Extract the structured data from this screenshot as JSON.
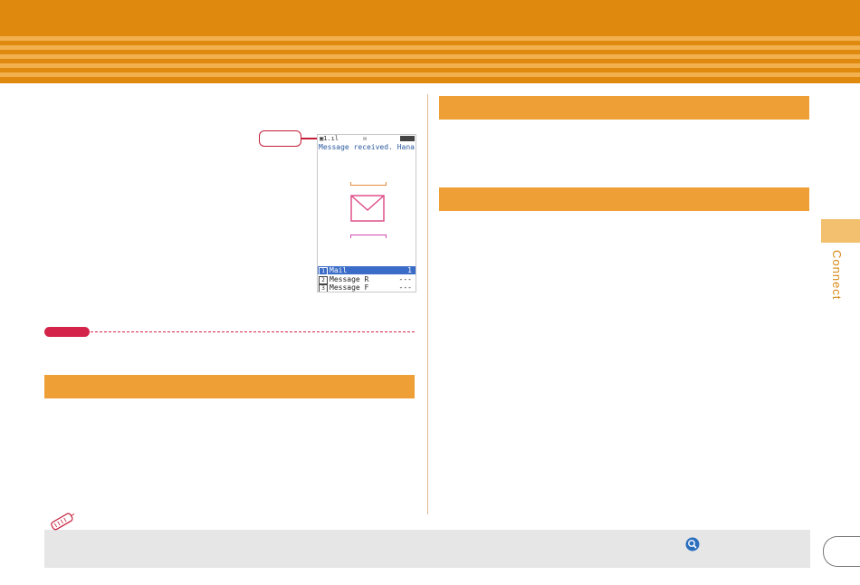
{
  "phone_screen": {
    "status_antenna": "▣1.ıl",
    "notification": "Message received. Hanako",
    "menu": [
      {
        "num": "1",
        "label": "Mail",
        "count": "1",
        "selected": true
      },
      {
        "num": "2",
        "label": "Message R",
        "count": "---",
        "selected": false
      },
      {
        "num": "3",
        "label": "Message F",
        "count": "---",
        "selected": false
      }
    ]
  },
  "side_tab": {
    "label": "Connect"
  },
  "colors": {
    "header": "#e0890f",
    "section_bar": "#ee9f35",
    "accent_red": "#d4244a",
    "side_tab": "#f2c06e",
    "footer_box": "#e6e6e6"
  },
  "icons": {
    "memo": "memo-pen-icon",
    "magnifier": "magnifier-icon",
    "envelope": "envelope-icon"
  }
}
